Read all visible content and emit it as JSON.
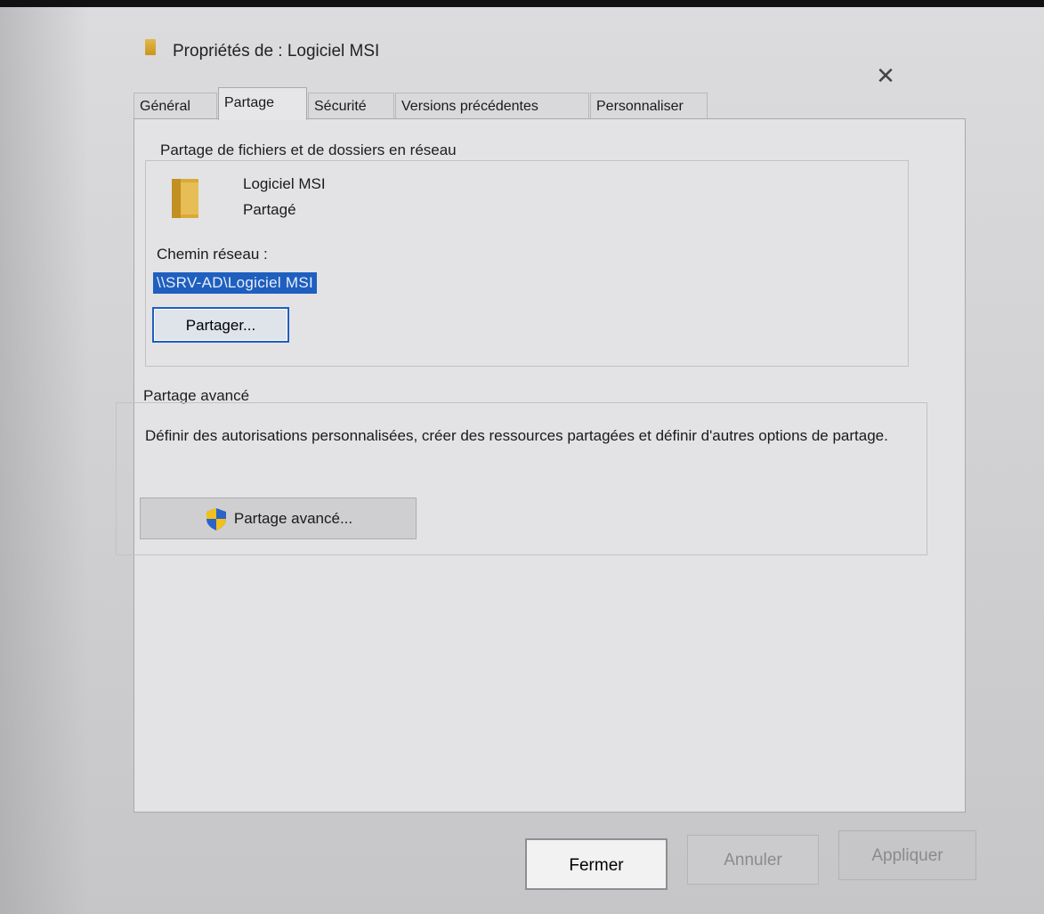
{
  "window": {
    "title": "Propriétés de : Logiciel MSI",
    "close_glyph": "✕"
  },
  "tabs": [
    {
      "label": "Général"
    },
    {
      "label": "Partage",
      "active": true
    },
    {
      "label": "Sécurité"
    },
    {
      "label": "Versions précédentes"
    },
    {
      "label": "Personnaliser"
    }
  ],
  "network_sharing": {
    "heading": "Partage de fichiers et de dossiers en réseau",
    "folder_name": "Logiciel MSI",
    "folder_status": "Partagé",
    "path_label": "Chemin réseau :",
    "path_value": "\\\\SRV-AD\\Logiciel MSI",
    "share_button": "Partager..."
  },
  "advanced_sharing": {
    "heading": "Partage avancé",
    "description": "Définir des autorisations personnalisées, créer des ressources partagées et définir d'autres options de partage.",
    "button": "Partage avancé..."
  },
  "footer": {
    "close_button": "Fermer",
    "cancel_button": "Annuler",
    "apply_button": "Appliquer"
  },
  "colors": {
    "selection": "#1e5fbf",
    "folder": "#d9a93a",
    "shield_blue": "#2a64c8",
    "shield_yellow": "#f2c01a"
  },
  "icons": [
    "folder-icon",
    "shield-icon",
    "close-icon"
  ]
}
